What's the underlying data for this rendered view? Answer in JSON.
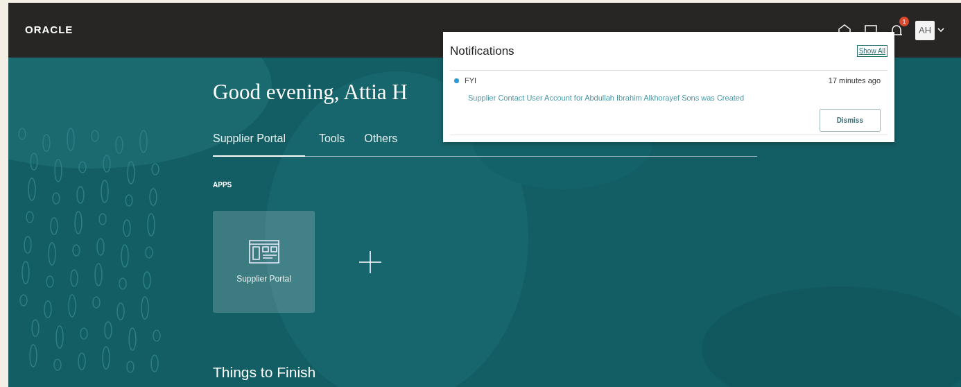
{
  "header": {
    "logo": "ORACLE",
    "notification_count": "1",
    "avatar": "AH"
  },
  "greeting": "Good evening, Attia H",
  "tabs": [
    {
      "label": "Supplier Portal",
      "selected": true
    },
    {
      "label": "Tools",
      "selected": false
    },
    {
      "label": "Others",
      "selected": false
    }
  ],
  "apps_heading": "APPS",
  "apps": [
    {
      "label": "Supplier Portal"
    }
  ],
  "things_to_finish": "Things to Finish",
  "notifications": {
    "title": "Notifications",
    "show_all": "Show All",
    "items": [
      {
        "type": "FYI",
        "time": "17 minutes ago",
        "message": "Supplier Contact User Account for Abdullah Ibrahim Alkhorayef Sons was Created",
        "unread": true,
        "action": "Dismiss"
      }
    ]
  }
}
